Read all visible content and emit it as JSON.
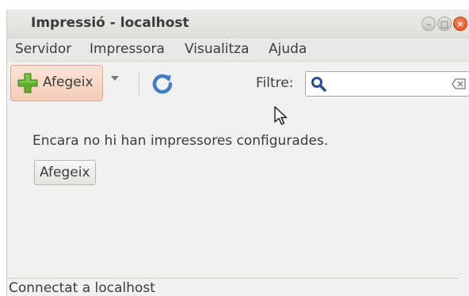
{
  "window": {
    "title": "Impressió - localhost",
    "controls": {
      "minimize": "–",
      "maximize": "□",
      "close": "×"
    }
  },
  "menu": {
    "items": [
      "Servidor",
      "Impressora",
      "Visualitza",
      "Ajuda"
    ]
  },
  "toolbar": {
    "add_label": "Afegeix",
    "filter_label": "Filtre:",
    "filter_value": "",
    "filter_placeholder": ""
  },
  "content": {
    "empty_message": "Encara no hi han impressores configurades.",
    "add_button_label": "Afegeix"
  },
  "statusbar": {
    "text": "Connectat a localhost"
  },
  "icons": {
    "add": "plus-icon",
    "dropdown": "chevron-down-icon",
    "refresh": "refresh-icon",
    "search": "search-icon",
    "clear": "clear-text-icon",
    "cursor": "mouse-cursor-icon"
  },
  "colors": {
    "add_plus": "#5fae2a",
    "refresh": "#3f7fc9",
    "close_button": "#df4b16",
    "active_button_bg": "#f5cdb9"
  }
}
